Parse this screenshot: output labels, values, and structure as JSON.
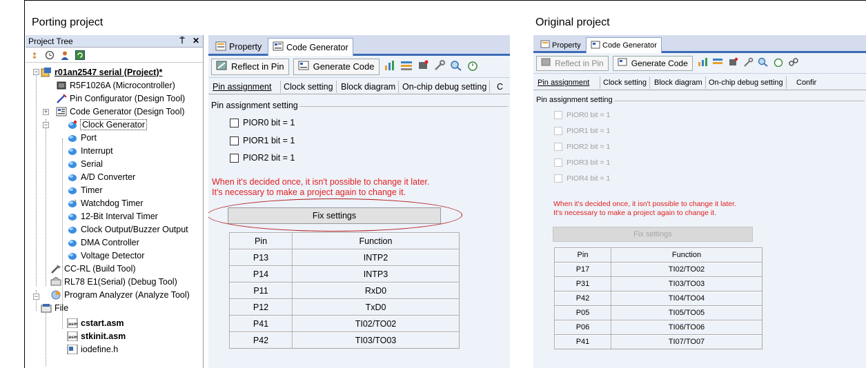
{
  "captions": {
    "left": "Porting project",
    "right": "Original project"
  },
  "project_tree": {
    "title": "Project Tree",
    "controls": "p ✕",
    "items": [
      {
        "label": "r01an2547 serial (Project)*",
        "icon": "project-icon"
      },
      {
        "label": "R5F1026A (Microcontroller)",
        "icon": "microcontroller-icon"
      },
      {
        "label": "Pin Configurator (Design Tool)",
        "icon": "pin-configurator-icon"
      },
      {
        "label": "Code Generator (Design Tool)",
        "icon": "code-generator-icon"
      },
      {
        "label": "Clock Generator",
        "icon": "module-icon"
      },
      {
        "label": "Port",
        "icon": "module-icon"
      },
      {
        "label": "Interrupt",
        "icon": "module-icon"
      },
      {
        "label": "Serial",
        "icon": "module-icon"
      },
      {
        "label": "A/D Converter",
        "icon": "module-icon"
      },
      {
        "label": "Timer",
        "icon": "module-icon"
      },
      {
        "label": "Watchdog Timer",
        "icon": "module-icon"
      },
      {
        "label": "12-Bit Interval Timer",
        "icon": "module-icon"
      },
      {
        "label": "Clock Output/Buzzer Output",
        "icon": "module-icon"
      },
      {
        "label": "DMA Controller",
        "icon": "module-icon"
      },
      {
        "label": "Voltage Detector",
        "icon": "module-icon"
      },
      {
        "label": "CC-RL (Build Tool)",
        "icon": "build-tool-icon"
      },
      {
        "label": "RL78 E1(Serial) (Debug Tool)",
        "icon": "debug-tool-icon"
      },
      {
        "label": "Program Analyzer (Analyze Tool)",
        "icon": "analyzer-icon"
      },
      {
        "label": "File",
        "icon": "folder-icon"
      },
      {
        "label": "cstart.asm",
        "icon": "asm-file-icon"
      },
      {
        "label": "stkinit.asm",
        "icon": "asm-file-icon"
      },
      {
        "label": "iodefine.h",
        "icon": "header-file-icon"
      }
    ]
  },
  "left_panel": {
    "tabs": [
      "Property",
      "Code Generator"
    ],
    "toolbar": {
      "reflect": "Reflect in Pin",
      "generate": "Generate Code"
    },
    "subtabs": [
      "Pin assignment",
      "Clock setting",
      "Block diagram",
      "On-chip debug setting",
      "C"
    ],
    "group_title": "Pin assignment setting",
    "checkboxes": [
      "PIOR0 bit = 1",
      "PIOR1 bit = 1",
      "PIOR2 bit = 1"
    ],
    "warning_line1": "When it's decided once, it isn't possible to change it later.",
    "warning_line2": "It's necessary to make a project again to change it.",
    "fix_button": "Fix settings",
    "table_headers": [
      "Pin",
      "Function"
    ],
    "table_rows": [
      [
        "P13",
        "INTP2"
      ],
      [
        "P14",
        "INTP3"
      ],
      [
        "P11",
        "RxD0"
      ],
      [
        "P12",
        "TxD0"
      ],
      [
        "P41",
        "TI02/TO02"
      ],
      [
        "P42",
        "TI03/TO03"
      ]
    ],
    "highlight_color": "#b01919",
    "warning_color": "#e02020"
  },
  "right_panel": {
    "tabs": [
      "Property",
      "Code Generator"
    ],
    "toolbar": {
      "reflect": "Reflect in Pin",
      "generate": "Generate Code"
    },
    "subtabs": [
      "Pin assignment",
      "Clock setting",
      "Block diagram",
      "On-chip debug setting",
      "Confir"
    ],
    "group_title": "Pin assignment setting",
    "checkboxes": [
      "PIOR0 bit = 1",
      "PIOR1 bit = 1",
      "PIOR2 bit = 1",
      "PIOR3 bit = 1",
      "PIOR4 bit = 1"
    ],
    "warning_line1": "When it's decided once, it isn't possible to change it later.",
    "warning_line2": "It's necessary to make a project again to change it.",
    "fix_button": "Fix settings",
    "table_headers": [
      "Pin",
      "Function"
    ],
    "table_rows": [
      [
        "P17",
        "TI02/TO02"
      ],
      [
        "P31",
        "TI03/TO03"
      ],
      [
        "P42",
        "TI04/TO04"
      ],
      [
        "P05",
        "TI05/TO05"
      ],
      [
        "P06",
        "TI06/TO06"
      ],
      [
        "P41",
        "TI07/TO07"
      ]
    ]
  }
}
